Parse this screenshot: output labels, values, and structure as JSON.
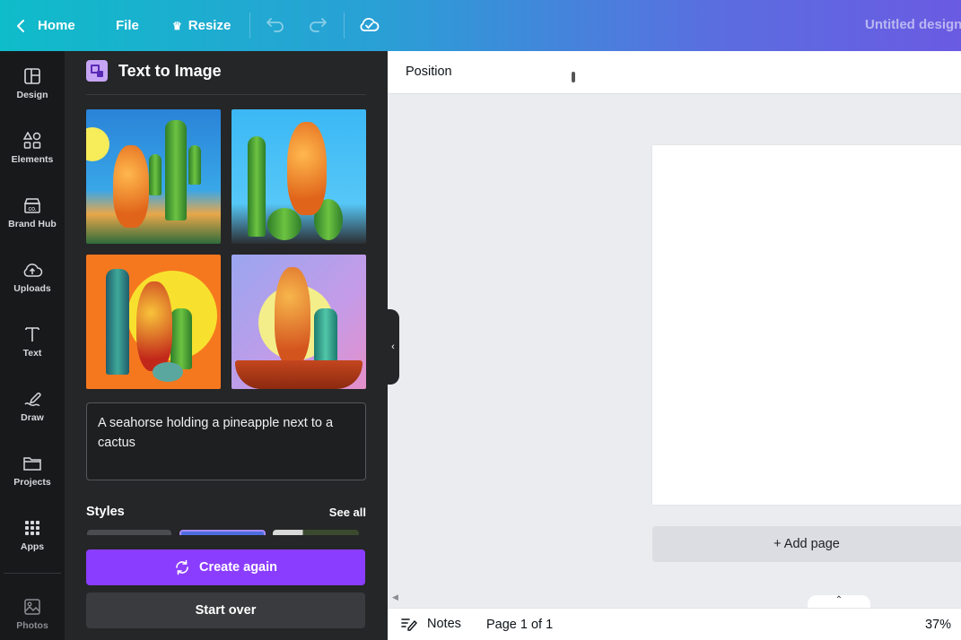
{
  "topbar": {
    "home": "Home",
    "file": "File",
    "resize": "Resize",
    "title": "Untitled design"
  },
  "rail": {
    "items": [
      {
        "label": "Design",
        "icon": "layout-icon"
      },
      {
        "label": "Elements",
        "icon": "shapes-icon"
      },
      {
        "label": "Brand Hub",
        "icon": "brand-icon"
      },
      {
        "label": "Uploads",
        "icon": "cloud-upload-icon"
      },
      {
        "label": "Text",
        "icon": "text-icon"
      },
      {
        "label": "Draw",
        "icon": "draw-icon"
      },
      {
        "label": "Projects",
        "icon": "folder-icon"
      },
      {
        "label": "Apps",
        "icon": "apps-grid-icon"
      },
      {
        "label": "Photos",
        "icon": "image-icon"
      }
    ]
  },
  "panel": {
    "title": "Text to Image",
    "prompt": "A seahorse holding a pineapple next to a cactus",
    "styles_label": "Styles",
    "see_all": "See all",
    "create_again": "Create again",
    "start_over": "Start over"
  },
  "canvas": {
    "position": "Position",
    "add_page": "+ Add page"
  },
  "footer": {
    "notes": "Notes",
    "page_count": "Page 1 of 1",
    "zoom": "37%"
  },
  "colors": {
    "accent": "#8b3dff",
    "panel_bg": "#252627",
    "rail_bg": "#18191b"
  }
}
